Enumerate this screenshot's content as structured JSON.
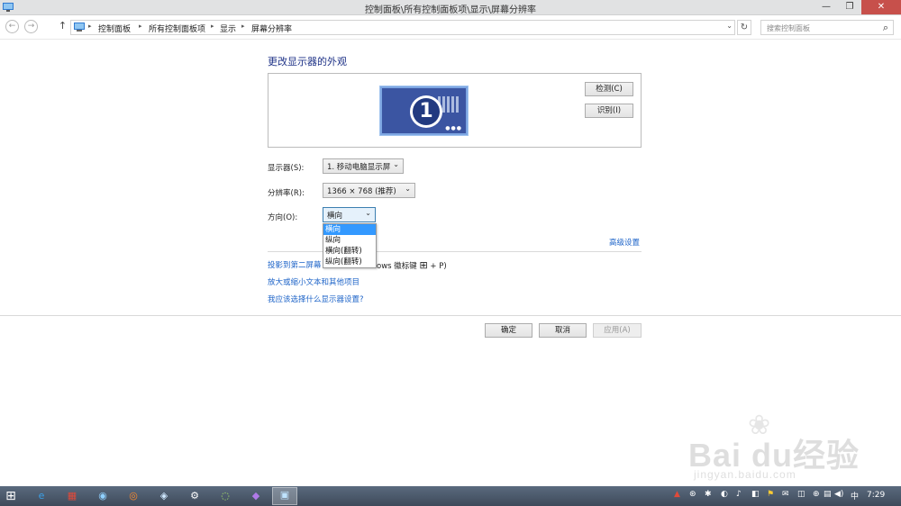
{
  "window": {
    "title": "控制面板\\所有控制面板项\\显示\\屏幕分辨率",
    "minimize_glyph": "—",
    "maximize_glyph": "❐",
    "close_glyph": "✕"
  },
  "address": {
    "back_glyph": "←",
    "forward_glyph": "→",
    "up_glyph": "↑",
    "breadcrumbs": [
      "控制面板",
      "所有控制面板项",
      "显示",
      "屏幕分辨率"
    ],
    "separator": "▸",
    "dropdown_glyph": "⌄",
    "refresh_glyph": "↻",
    "search_placeholder": "搜索控制面板",
    "search_icon": "⌕"
  },
  "page": {
    "heading": "更改显示器的外观",
    "monitor_number": "1",
    "monitor_dots": "●●●",
    "detect_button": "检测(C)",
    "identify_button": "识别(I)",
    "display_label": "显示器(S):",
    "display_value": "1. 移动电脑显示屏",
    "resolution_label": "分辨率(R):",
    "resolution_value": "1366 × 768 (推荐)",
    "orientation_label": "方向(O):",
    "orientation_value": "横向",
    "orientation_options": [
      "横向",
      "纵向",
      "横向(翻转)",
      "纵向(翻转)"
    ],
    "advanced_link": "高级设置",
    "project_link": "投影到第二屏幕",
    "project_text_suffix": "ows 徽标键",
    "project_shortcut": "+ P)",
    "enlarge_link": "放大或缩小文本和其他项目",
    "which_settings_link": "我应该选择什么显示器设置?",
    "ok_button": "确定",
    "cancel_button": "取消",
    "apply_button": "应用(A)",
    "arrow_glyph": "⌄",
    "windows_logo_glyph": "⊞"
  },
  "taskbar": {
    "start_glyph": "⊞",
    "apps": [
      "e",
      "▦",
      "◉",
      "◎",
      "◈",
      "⚙",
      "◌",
      "◆",
      "▣"
    ],
    "tray_icons": [
      "▲",
      "⊛",
      "✱",
      "◐",
      "♪",
      "◧",
      "⚑",
      "✉",
      "◫",
      "⊕",
      "▤",
      "◀)",
      "中"
    ],
    "time": "7:29"
  },
  "watermark": {
    "brand": "Bai  du经验",
    "paw": "❀",
    "site": "jingyan.baidu.com"
  },
  "colors": {
    "heading": "#1e3287",
    "link": "#1e64c8",
    "close_button": "#c7504b",
    "monitor_fill": "#3b55a2",
    "dropdown_selection": "#3399ff"
  }
}
